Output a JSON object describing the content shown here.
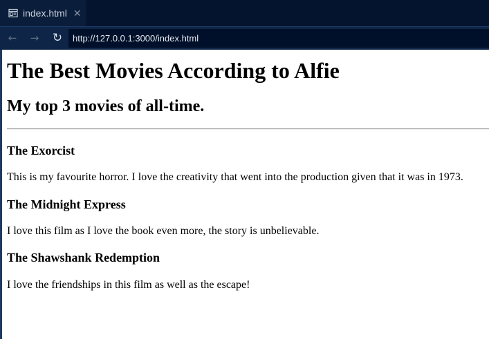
{
  "browser": {
    "tab": {
      "title": "index.html",
      "close_glyph": "✕",
      "icon": "page-icon"
    },
    "nav": {
      "back_glyph": "←",
      "forward_glyph": "→",
      "reload_glyph": "↻"
    },
    "address_bar": {
      "url": "http://127.0.0.1:3000/index.html"
    }
  },
  "page": {
    "title": "The Best Movies According to Alfie",
    "subtitle": "My top 3 movies of all-time.",
    "movies": [
      {
        "title": "The Exorcist",
        "description": "This is my favourite horror. I love the creativity that went into the production given that it was in 1973."
      },
      {
        "title": "The Midnight Express",
        "description": "I love this film as I love the book even more, the story is unbelievable."
      },
      {
        "title": "The Shawshank Redemption",
        "description": "I love the friendships in this film as well as the escape!"
      }
    ]
  },
  "colors": {
    "tabbar_bg": "#04142e",
    "navbar_bg": "#0f2547",
    "address_bg": "#00102a",
    "page_bg": "#ffffff"
  }
}
